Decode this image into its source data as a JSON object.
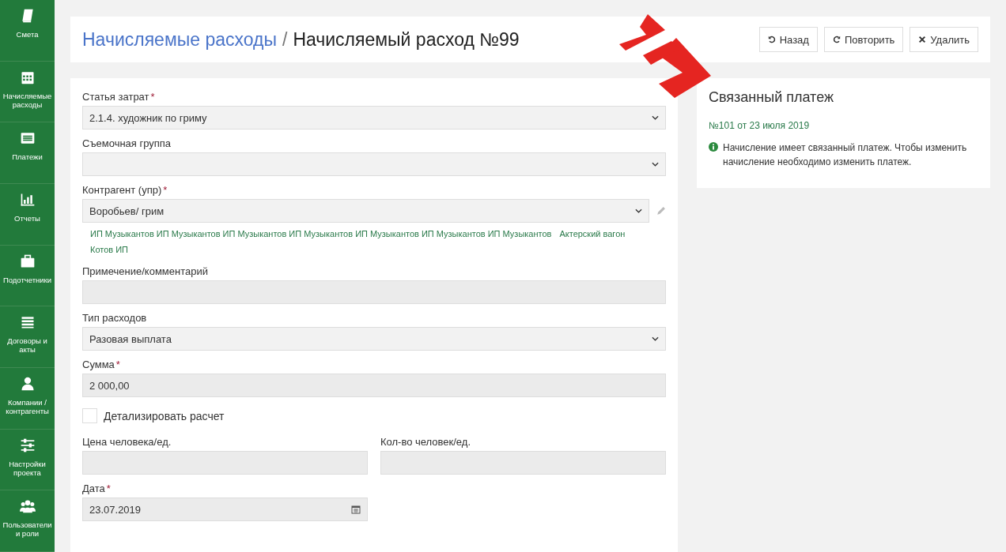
{
  "sidebar": {
    "items": [
      {
        "label": "Смета"
      },
      {
        "label": "Начисляемые расходы"
      },
      {
        "label": "Платежи"
      },
      {
        "label": "Отчеты"
      },
      {
        "label": "Подотчетники"
      },
      {
        "label": "Договоры и акты"
      },
      {
        "label": "Компании / контрагенты"
      },
      {
        "label": "Настройки проекта"
      },
      {
        "label": "Пользователи и роли"
      }
    ]
  },
  "header": {
    "breadcrumb_link": "Начисляемые расходы",
    "separator": "/",
    "title": "Начисляемый расход №99",
    "buttons": [
      {
        "label": "Назад"
      },
      {
        "label": "Повторить"
      },
      {
        "label": "Удалить"
      }
    ]
  },
  "form": {
    "fields": [
      {
        "kind": "select",
        "label": "Статья затрат",
        "required_mark": "*",
        "value": "2.1.4. художник по гриму"
      },
      {
        "kind": "select",
        "label": "Съемочная группа"
      },
      {
        "kind": "select_edit",
        "label": "Контрагент (упр)",
        "required_mark": "*",
        "value": "Воробьев/ грим",
        "links": [
          "ИП Музыкантов ИП Музыкантов ИП Музыкантов ИП Музыкантов ИП Музыкантов ИП Музыкантов ИП Музыкантов",
          "Актерский вагон",
          "Котов ИП"
        ]
      },
      {
        "kind": "text",
        "label": "Примечение/комментарий"
      },
      {
        "kind": "select",
        "label": "Тип расходов",
        "value": "Разовая выплата"
      },
      {
        "kind": "text",
        "label": "Сумма",
        "required_mark": "*",
        "value": "2 000,00"
      },
      {
        "kind": "checkbox",
        "label": "Детализировать расчет",
        "checked": false
      },
      {
        "kind": "pair",
        "items": [
          {
            "label": "Цена человека/ед."
          },
          {
            "label": "Кол-во человек/ед."
          }
        ]
      },
      {
        "kind": "date",
        "label": "Дата",
        "required_mark": "*",
        "value": "23.07.2019"
      }
    ]
  },
  "related": {
    "title": "Связанный платеж",
    "payment_link": "№101 от 23 июля 2019",
    "info": "Начисление имеет связанный платеж. Чтобы изменить начисление необходимо изменить платеж."
  }
}
